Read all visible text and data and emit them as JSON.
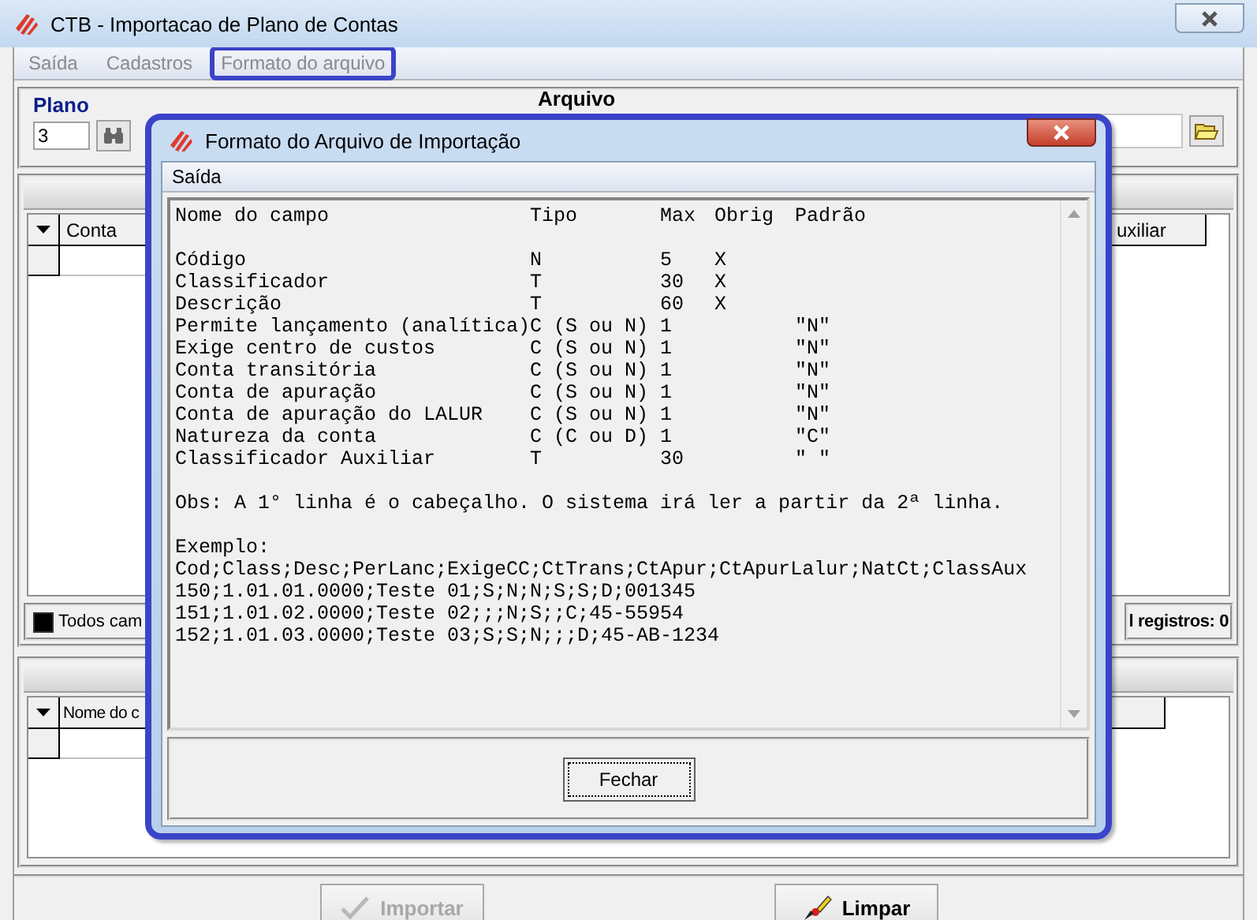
{
  "window": {
    "title": "CTB - Importacao de Plano de Contas"
  },
  "menu": [
    {
      "label": "Saída",
      "highlighted": false
    },
    {
      "label": "Cadastros",
      "highlighted": false
    },
    {
      "label": "Formato do arquivo",
      "highlighted": true
    }
  ],
  "plano": {
    "label": "Plano",
    "value": "3"
  },
  "arquivo": {
    "label": "Arquivo"
  },
  "accounts_grid": {
    "columns": [
      "Conta",
      "uxiliar"
    ]
  },
  "all_fields": {
    "label": "Todos cam",
    "checked": true
  },
  "total": "l registros: 0",
  "fields_grid": {
    "columns": [
      "Nome do c"
    ]
  },
  "buttons": [
    {
      "label": "Importar",
      "disabled": true,
      "kind": "import"
    },
    {
      "label": "Limpar",
      "disabled": false,
      "kind": "clear"
    }
  ],
  "dialog": {
    "title": "Formato do Arquivo de Importação",
    "menu": [
      "Saída"
    ],
    "header": {
      "name": "Nome do campo",
      "type": "Tipo",
      "max": "Max",
      "required": "Obrig",
      "default": "Padrão"
    },
    "fields": [
      {
        "name": "Código",
        "type": "N",
        "max": "5",
        "required": "X"
      },
      {
        "name": "Classificador",
        "type": "T",
        "max": "30",
        "required": "X"
      },
      {
        "name": "Descrição",
        "type": "T",
        "max": "60",
        "required": "X"
      },
      {
        "name": "Permite lançamento (analítica)",
        "type": "C (S ou N)",
        "max": "1",
        "default": "\"N\""
      },
      {
        "name": "Exige centro de custos",
        "type": "C (S ou N)",
        "max": "1",
        "default": "\"N\""
      },
      {
        "name": "Conta transitória",
        "type": "C (S ou N)",
        "max": "1",
        "default": "\"N\""
      },
      {
        "name": "Conta de apuração",
        "type": "C (S ou N)",
        "max": "1",
        "default": "\"N\""
      },
      {
        "name": "Conta de apuração do LALUR",
        "type": "C (S ou N)",
        "max": "1",
        "default": "\"N\""
      },
      {
        "name": "Natureza da conta",
        "type": "C (C ou D)",
        "max": "1",
        "default": "\"C\""
      },
      {
        "name": "Classificador Auxiliar",
        "type": "T",
        "max": "30",
        "default": "\" \""
      }
    ],
    "note": "Obs: A 1° linha é o cabeçalho. O sistema irá ler a partir da 2ª linha.",
    "example_label": "Exemplo:",
    "example_lines": [
      "Cod;Class;Desc;PerLanc;ExigeCC;CtTrans;CtApur;CtApurLalur;NatCt;ClassAux",
      "150;1.01.01.0000;Teste 01;S;N;N;S;S;D;001345",
      "151;1.01.02.0000;Teste 02;;;N;S;;C;45-55954",
      "152;1.01.03.0000;Teste 03;S;S;N;;;D;45-AB-1234"
    ],
    "close_button": "Fechar"
  }
}
